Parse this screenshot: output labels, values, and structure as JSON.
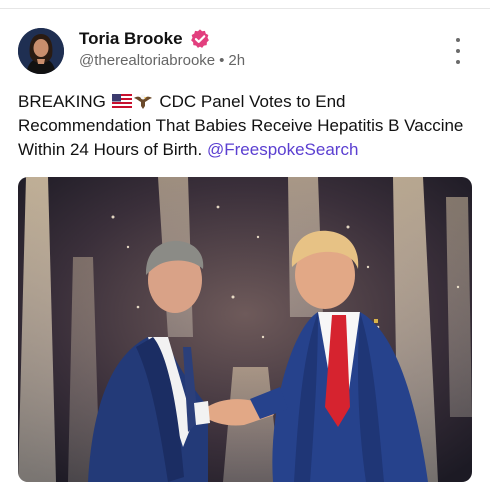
{
  "post": {
    "author": {
      "display_name": "Toria Brooke",
      "handle": "@therealtoriabrooke",
      "verified": true,
      "avatar_icon": "avatar-photo"
    },
    "separator": "•",
    "timestamp": "2h",
    "text": {
      "lead": "BREAKING",
      "emojis": [
        "us-flag-icon",
        "eagle-icon"
      ],
      "body": "CDC Panel Votes to End Recommendation That Babies Receive Hepatitis B Vaccine Within 24 Hours of Birth.",
      "mention": "@FreespokeSearch"
    },
    "image": {
      "icon": "photo-two-men-shaking-hands-fireworks"
    }
  },
  "colors": {
    "verified_badge": "#e23f7e",
    "mention": "#5b3fd1",
    "meta_text": "#666666"
  }
}
